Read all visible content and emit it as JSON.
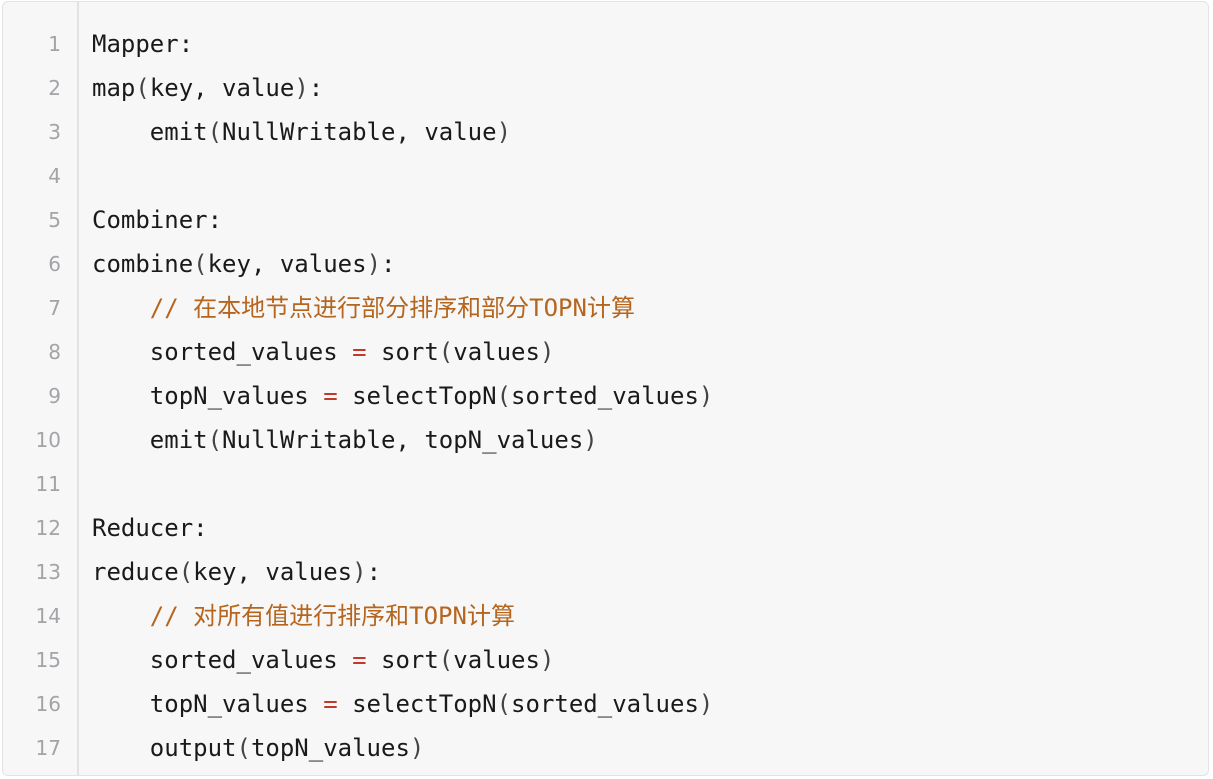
{
  "code": {
    "lines": [
      {
        "no": "1",
        "indent": "",
        "parts": [
          {
            "t": "Mapper:",
            "k": "plain"
          }
        ]
      },
      {
        "no": "2",
        "indent": "",
        "parts": [
          {
            "t": "map",
            "k": "plain"
          },
          {
            "t": "(",
            "k": "punc"
          },
          {
            "t": "key, value",
            "k": "plain"
          },
          {
            "t": ")",
            "k": "punc"
          },
          {
            "t": ":",
            "k": "plain"
          }
        ]
      },
      {
        "no": "3",
        "indent": "    ",
        "parts": [
          {
            "t": "emit",
            "k": "plain"
          },
          {
            "t": "(",
            "k": "punc"
          },
          {
            "t": "NullWritable, value",
            "k": "plain"
          },
          {
            "t": ")",
            "k": "punc"
          }
        ]
      },
      {
        "no": "4",
        "indent": "",
        "parts": []
      },
      {
        "no": "5",
        "indent": "",
        "parts": [
          {
            "t": "Combiner:",
            "k": "plain"
          }
        ]
      },
      {
        "no": "6",
        "indent": "",
        "parts": [
          {
            "t": "combine",
            "k": "plain"
          },
          {
            "t": "(",
            "k": "punc"
          },
          {
            "t": "key, values",
            "k": "plain"
          },
          {
            "t": ")",
            "k": "punc"
          },
          {
            "t": ":",
            "k": "plain"
          }
        ]
      },
      {
        "no": "7",
        "indent": "    ",
        "parts": [
          {
            "t": "// 在本地节点进行部分排序和部分TOPN计算",
            "k": "comment"
          }
        ]
      },
      {
        "no": "8",
        "indent": "    ",
        "parts": [
          {
            "t": "sorted_values ",
            "k": "plain"
          },
          {
            "t": "=",
            "k": "op"
          },
          {
            "t": " sort",
            "k": "plain"
          },
          {
            "t": "(",
            "k": "punc"
          },
          {
            "t": "values",
            "k": "plain"
          },
          {
            "t": ")",
            "k": "punc"
          }
        ]
      },
      {
        "no": "9",
        "indent": "    ",
        "parts": [
          {
            "t": "topN_values ",
            "k": "plain"
          },
          {
            "t": "=",
            "k": "op"
          },
          {
            "t": " selectTopN",
            "k": "plain"
          },
          {
            "t": "(",
            "k": "punc"
          },
          {
            "t": "sorted_values",
            "k": "plain"
          },
          {
            "t": ")",
            "k": "punc"
          }
        ]
      },
      {
        "no": "10",
        "indent": "    ",
        "parts": [
          {
            "t": "emit",
            "k": "plain"
          },
          {
            "t": "(",
            "k": "punc"
          },
          {
            "t": "NullWritable, topN_values",
            "k": "plain"
          },
          {
            "t": ")",
            "k": "punc"
          }
        ]
      },
      {
        "no": "11",
        "indent": "",
        "parts": []
      },
      {
        "no": "12",
        "indent": "",
        "parts": [
          {
            "t": "Reducer:",
            "k": "plain"
          }
        ]
      },
      {
        "no": "13",
        "indent": "",
        "parts": [
          {
            "t": "reduce",
            "k": "plain"
          },
          {
            "t": "(",
            "k": "punc"
          },
          {
            "t": "key, values",
            "k": "plain"
          },
          {
            "t": ")",
            "k": "punc"
          },
          {
            "t": ":",
            "k": "plain"
          }
        ]
      },
      {
        "no": "14",
        "indent": "    ",
        "parts": [
          {
            "t": "// 对所有值进行排序和TOPN计算",
            "k": "comment"
          }
        ]
      },
      {
        "no": "15",
        "indent": "    ",
        "parts": [
          {
            "t": "sorted_values ",
            "k": "plain"
          },
          {
            "t": "=",
            "k": "op"
          },
          {
            "t": " sort",
            "k": "plain"
          },
          {
            "t": "(",
            "k": "punc"
          },
          {
            "t": "values",
            "k": "plain"
          },
          {
            "t": ")",
            "k": "punc"
          }
        ]
      },
      {
        "no": "16",
        "indent": "    ",
        "parts": [
          {
            "t": "topN_values ",
            "k": "plain"
          },
          {
            "t": "=",
            "k": "op"
          },
          {
            "t": " selectTopN",
            "k": "plain"
          },
          {
            "t": "(",
            "k": "punc"
          },
          {
            "t": "sorted_values",
            "k": "plain"
          },
          {
            "t": ")",
            "k": "punc"
          }
        ]
      },
      {
        "no": "17",
        "indent": "    ",
        "parts": [
          {
            "t": "output",
            "k": "plain"
          },
          {
            "t": "(",
            "k": "punc"
          },
          {
            "t": "topN_values",
            "k": "plain"
          },
          {
            "t": ")",
            "k": "punc"
          }
        ]
      }
    ]
  },
  "colors": {
    "background": "#f7f7f8",
    "text": "#1a1a1a",
    "line_number": "#a3a3a8",
    "operator": "#c0392b",
    "comment": "#b5651d"
  }
}
